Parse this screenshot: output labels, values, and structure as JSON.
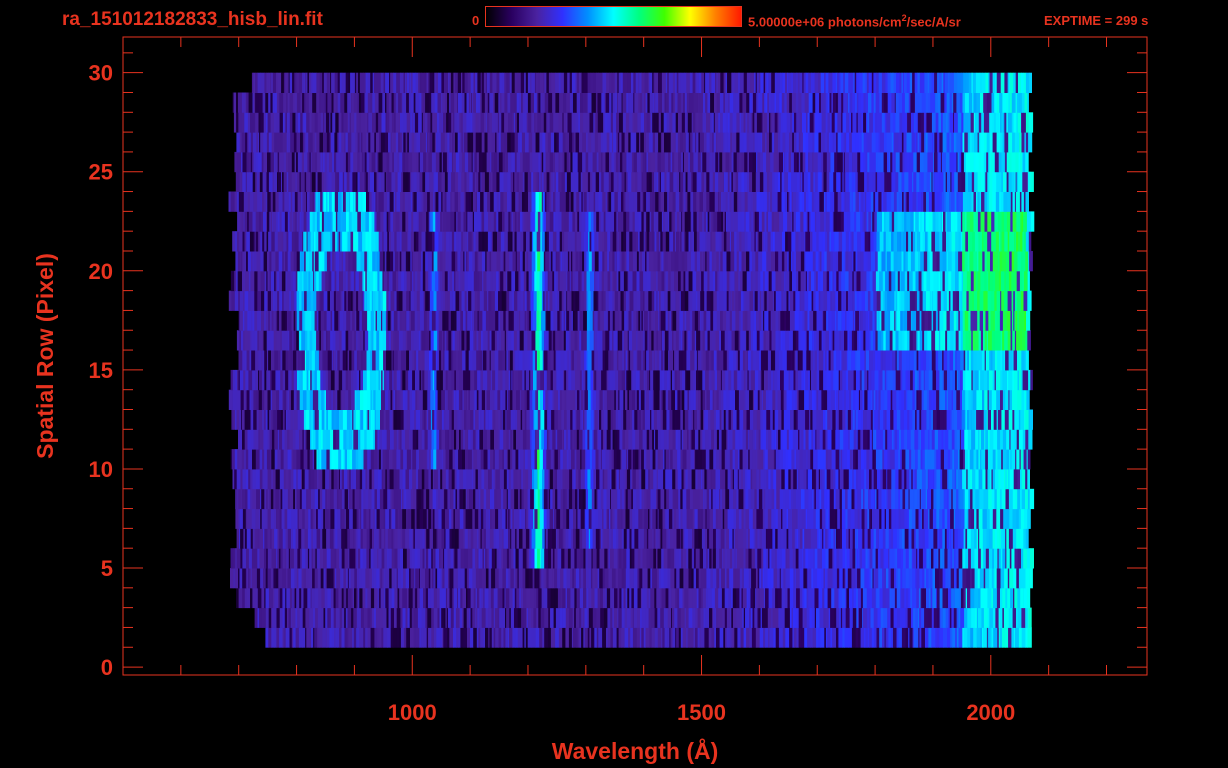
{
  "header": {
    "file_name": "ra_151012182833_hisb_lin.fit",
    "colorbar_min": "0",
    "colorbar_max_value": "5.00000e+06 photons/cm",
    "colorbar_max_sup": "2",
    "colorbar_max_rest": "/sec/A/sr",
    "exptime": "EXPTIME = 299 s"
  },
  "colors": {
    "axis": "#e8331f",
    "background": "#000000",
    "colormap": [
      "#000000",
      "#2a0060",
      "#4a22a0",
      "#3030ff",
      "#0090ff",
      "#00ffff",
      "#00ff80",
      "#40ff00",
      "#ffff00",
      "#ff8000",
      "#ff1a00"
    ]
  },
  "chart_data": {
    "type": "heatmap",
    "xlabel": "Wavelength (Å)",
    "ylabel": "Spatial Row (Pixel)",
    "xlim": [
      500,
      2270
    ],
    "ylim": [
      -0.4,
      31.8
    ],
    "x_ticks": [
      1000,
      1500,
      2000
    ],
    "x_tick_labels": [
      "1000",
      "1500",
      "2000"
    ],
    "y_ticks": [
      0,
      5,
      10,
      15,
      20,
      25,
      30
    ],
    "y_tick_labels": [
      "0",
      "5",
      "10",
      "15",
      "20",
      "25",
      "30"
    ],
    "colorscale_range": [
      0,
      5000000
    ],
    "colorscale_unit": "photons/cm^2/sec/A/sr",
    "data_extent": {
      "x": [
        680,
        2070
      ],
      "y": [
        1.5,
        30
      ]
    },
    "features": [
      {
        "feature": "bright emission line",
        "x": 1216,
        "y_range": [
          5,
          24
        ]
      },
      {
        "feature": "emission line",
        "x": 1304,
        "y_range": [
          6,
          23
        ]
      },
      {
        "feature": "emission arc",
        "x_range": [
          800,
          950
        ],
        "y_range": [
          10,
          24
        ]
      },
      {
        "feature": "emission line",
        "x": 1035,
        "y_range": [
          10,
          23
        ]
      },
      {
        "feature": "bright band",
        "x_range": [
          1800,
          2060
        ],
        "y_range": [
          16,
          23
        ]
      }
    ]
  }
}
